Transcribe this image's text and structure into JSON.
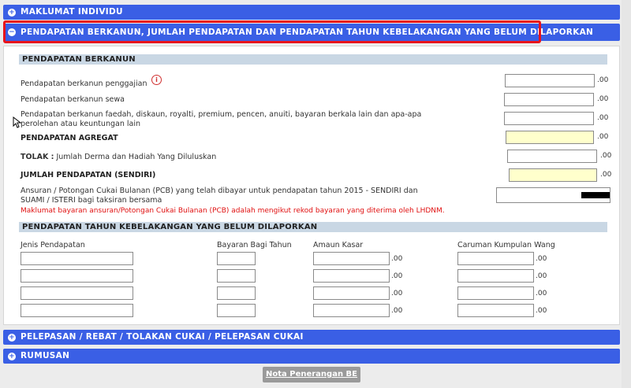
{
  "sections": {
    "maklumat_individu": "MAKLUMAT INDIVIDU",
    "pendapatan": "PENDAPATAN BERKANUN, JUMLAH PENDAPATAN DAN PENDAPATAN TAHUN KEBELAKANGAN YANG BELUM DILAPORKAN",
    "pelepasan": "PELEPASAN / REBAT / TOLAKAN CUKAI / PELEPASAN CUKAI",
    "rumusan": "RUMUSAN"
  },
  "icons": {
    "expand": "+",
    "collapse": "−",
    "info": "i"
  },
  "berkanun": {
    "heading": "PENDAPATAN BERKANUN",
    "gaji": "Pendapatan berkanun penggajian",
    "sewa": "Pendapatan berkanun sewa",
    "faedah_line1": "Pendapatan berkanun faedah, diskaun, royalti, premium, pencen, anuiti, bayaran berkala lain dan apa-apa",
    "faedah_line2": "perolehan atau keuntungan lain",
    "agregat": "PENDAPATAN AGREGAT",
    "tolak_prefix": "TOLAK :",
    "tolak": "Jumlah Derma dan Hadiah Yang Diluluskan",
    "jumlah": "JUMLAH PENDAPATAN (SENDIRI)",
    "pcb_line1": "Ansuran / Potongan Cukai Bulanan (PCB) yang telah dibayar untuk pendapatan tahun 2015 - SENDIRI dan",
    "pcb_line2": "SUAMI / ISTERI bagi taksiran bersama",
    "notice": "Maklumat bayaran ansuran/Potongan Cukai Bulanan (PCB) adalah mengikut rekod bayaran yang diterima oleh LHDNM.",
    "decimal": ".00"
  },
  "kebelakangan": {
    "heading": "PENDAPATAN TAHUN KEBELAKANGAN YANG BELUM DILAPORKAN",
    "col_jenis": "Jenis Pendapatan",
    "col_bayaran": "Bayaran Bagi Tahun",
    "col_amaun": "Amaun Kasar",
    "col_caruman": "Caruman Kumpulan Wang",
    "decimal": ".00"
  },
  "button": {
    "nota": "Nota Penerangan BE"
  }
}
